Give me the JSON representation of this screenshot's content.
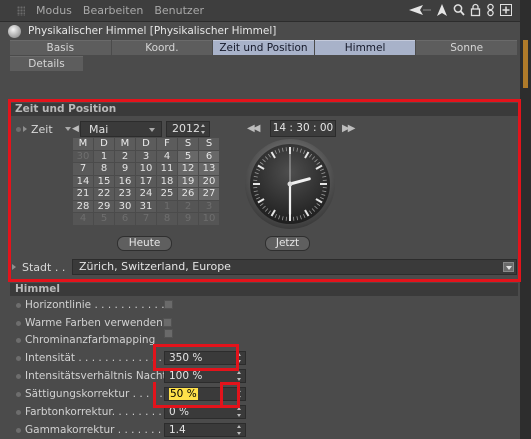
{
  "menubar": {
    "items": [
      "Modus",
      "Bearbeiten",
      "Benutzer"
    ]
  },
  "object": {
    "title": "Physikalischer Himmel [Physikalischer Himmel]"
  },
  "tabs": {
    "row1": [
      "Basis",
      "Koord.",
      "Zeit und Position",
      "Himmel",
      "Sonne"
    ],
    "row2": [
      "Details"
    ],
    "active": [
      "Zeit und Position",
      "Himmel"
    ]
  },
  "zeit_section": {
    "header": "Zeit und Position",
    "zeit_label": "Zeit",
    "month": "Mai",
    "year": "2012",
    "time": "14 : 30 : 00",
    "weekday_headers": [
      "M",
      "D",
      "M",
      "D",
      "F",
      "S",
      "S"
    ],
    "weeks": [
      [
        "30",
        "1",
        "2",
        "3",
        "4",
        "5",
        "6"
      ],
      [
        "7",
        "8",
        "9",
        "10",
        "11",
        "12",
        "13"
      ],
      [
        "14",
        "15",
        "16",
        "17",
        "18",
        "19",
        "20"
      ],
      [
        "21",
        "22",
        "23",
        "24",
        "25",
        "26",
        "27"
      ],
      [
        "28",
        "29",
        "30",
        "31",
        "1",
        "2",
        "3"
      ],
      [
        "4",
        "5",
        "6",
        "7",
        "8",
        "9",
        "10"
      ]
    ],
    "heute_label": "Heute",
    "jetzt_label": "Jetzt",
    "clock": {
      "hours": 14,
      "minutes": 30,
      "seconds": 0
    }
  },
  "stadt": {
    "label": "Stadt . .",
    "value": "Zürich, Switzerland, Europe"
  },
  "himmel_section": {
    "header": "Himmel",
    "properties": [
      {
        "label": "Horizontlinie . . . . . . . . . . .",
        "type": "checkbox"
      },
      {
        "label": "Warme Farben verwenden",
        "type": "checkbox"
      },
      {
        "label": "Chrominanzfarbmapping",
        "type": "checkbox"
      },
      {
        "label": "Intensität . . . . . . . . . . . . . .",
        "type": "number",
        "value": "350 %"
      },
      {
        "label": "Intensitätsverhältnis Nacht",
        "type": "number",
        "value": "100 %"
      },
      {
        "label": "Sättigungskorrektur . . . . .",
        "type": "number",
        "value_selected": "50 %"
      },
      {
        "label": "Farbtonkorrektur. . . . . . . .",
        "type": "number",
        "value": "0 %"
      },
      {
        "label": "Gammakorrektur . . . . . . . .",
        "type": "number",
        "value": "1.4"
      }
    ]
  },
  "colors": {
    "annotation_red": "#e3131b",
    "active_tab": "#a8b2c9",
    "selection_highlight": "#ffe14a"
  }
}
